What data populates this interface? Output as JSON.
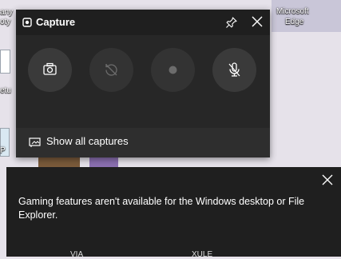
{
  "desktop": {
    "labels": [
      "any",
      "oty",
      "etu",
      "P",
      "Microsoft",
      "Edge"
    ]
  },
  "capture": {
    "title": "Capture",
    "title_icon": "capture-widget-icon",
    "buttons": [
      {
        "icon": "screenshot-camera-icon",
        "enabled": true
      },
      {
        "icon": "record-last-30-seconds-disabled-icon",
        "enabled": false
      },
      {
        "icon": "start-recording-icon",
        "enabled": false
      },
      {
        "icon": "microphone-off-icon",
        "enabled": true
      }
    ],
    "footer_label": "Show all captures"
  },
  "notification": {
    "message": "Gaming features aren't available for the Windows desktop or File Explorer.",
    "bottom_left": "VIA",
    "bottom_right": "XULE"
  },
  "colors": {
    "panel": "#272727",
    "titlebar": "#1f1f1f",
    "button": "#3a3a3a",
    "toast": "#1f1f1f",
    "text": "#ffffff",
    "desktop_bg": "#e6e2ea"
  }
}
